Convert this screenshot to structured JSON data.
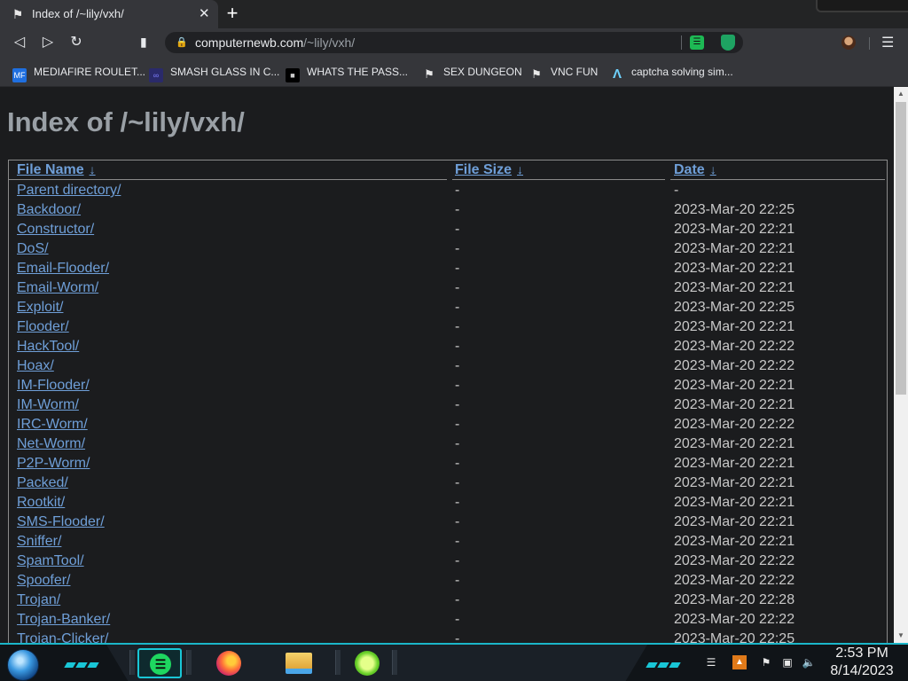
{
  "browser": {
    "tab_title": "Index of /~lily/vxh/",
    "url_host": "computernewb.com",
    "url_path": "/~lily/vxh/"
  },
  "bookmarks": [
    {
      "label": "MEDIAFIRE ROULET...",
      "icon": "mediafire-icon"
    },
    {
      "label": "SMASH GLASS IN C...",
      "icon": "visual-studio-icon"
    },
    {
      "label": "WHATS THE PASS...",
      "icon": "dark-site-icon"
    },
    {
      "label": "SEX DUNGEON",
      "icon": "ghost-icon"
    },
    {
      "label": "VNC FUN",
      "icon": "ghost-icon"
    },
    {
      "label": "captcha solving sim...",
      "icon": "lambda-icon"
    }
  ],
  "page": {
    "title": "Index of /~lily/vxh/",
    "columns": [
      {
        "label": "File Name",
        "arrow": "↓"
      },
      {
        "label": "File Size",
        "arrow": "↓"
      },
      {
        "label": "Date",
        "arrow": "↓"
      }
    ],
    "rows": [
      {
        "name": "Parent directory/",
        "size": "-",
        "date": "-"
      },
      {
        "name": "Backdoor/",
        "size": "-",
        "date": "2023-Mar-20 22:25"
      },
      {
        "name": "Constructor/",
        "size": "-",
        "date": "2023-Mar-20 22:21"
      },
      {
        "name": "DoS/",
        "size": "-",
        "date": "2023-Mar-20 22:21"
      },
      {
        "name": "Email-Flooder/",
        "size": "-",
        "date": "2023-Mar-20 22:21"
      },
      {
        "name": "Email-Worm/",
        "size": "-",
        "date": "2023-Mar-20 22:21"
      },
      {
        "name": "Exploit/",
        "size": "-",
        "date": "2023-Mar-20 22:25"
      },
      {
        "name": "Flooder/",
        "size": "-",
        "date": "2023-Mar-20 22:21"
      },
      {
        "name": "HackTool/",
        "size": "-",
        "date": "2023-Mar-20 22:22"
      },
      {
        "name": "Hoax/",
        "size": "-",
        "date": "2023-Mar-20 22:22"
      },
      {
        "name": "IM-Flooder/",
        "size": "-",
        "date": "2023-Mar-20 22:21"
      },
      {
        "name": "IM-Worm/",
        "size": "-",
        "date": "2023-Mar-20 22:21"
      },
      {
        "name": "IRC-Worm/",
        "size": "-",
        "date": "2023-Mar-20 22:22"
      },
      {
        "name": "Net-Worm/",
        "size": "-",
        "date": "2023-Mar-20 22:21"
      },
      {
        "name": "P2P-Worm/",
        "size": "-",
        "date": "2023-Mar-20 22:21"
      },
      {
        "name": "Packed/",
        "size": "-",
        "date": "2023-Mar-20 22:21"
      },
      {
        "name": "Rootkit/",
        "size": "-",
        "date": "2023-Mar-20 22:21"
      },
      {
        "name": "SMS-Flooder/",
        "size": "-",
        "date": "2023-Mar-20 22:21"
      },
      {
        "name": "Sniffer/",
        "size": "-",
        "date": "2023-Mar-20 22:21"
      },
      {
        "name": "SpamTool/",
        "size": "-",
        "date": "2023-Mar-20 22:22"
      },
      {
        "name": "Spoofer/",
        "size": "-",
        "date": "2023-Mar-20 22:22"
      },
      {
        "name": "Trojan/",
        "size": "-",
        "date": "2023-Mar-20 22:28"
      },
      {
        "name": "Trojan-Banker/",
        "size": "-",
        "date": "2023-Mar-20 22:22"
      },
      {
        "name": "Trojan-Clicker/",
        "size": "-",
        "date": "2023-Mar-20 22:25"
      }
    ]
  },
  "taskbar": {
    "apps": [
      "spotify-icon",
      "firefox-icon",
      "file-explorer-icon",
      "limewire-icon"
    ],
    "clock_time": "2:53 PM",
    "clock_date": "8/14/2023"
  },
  "colors": {
    "link": "#6f9fd8",
    "page_bg": "#1b1c1e",
    "taskbar_accent": "#1bb6c9"
  }
}
